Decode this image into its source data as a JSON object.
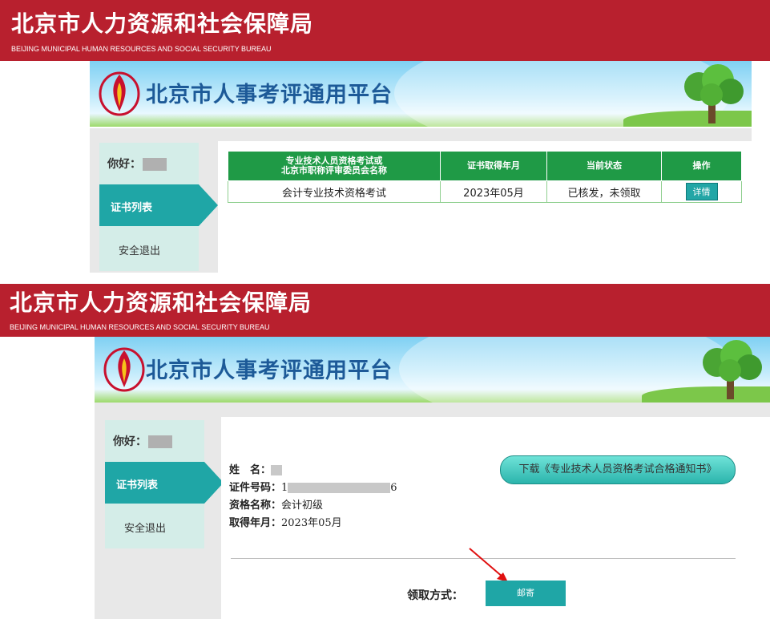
{
  "header": {
    "title_cn": "北京市人力资源和社会保障局",
    "title_en": "BEIJING MUNICIPAL HUMAN RESOURCES AND SOCIAL SECURITY BUREAU",
    "platform_title": "北京市人事考评通用平台"
  },
  "sidebar": {
    "greeting": "你好：",
    "items": [
      {
        "label": "证书列表"
      },
      {
        "label": "安全退出"
      }
    ]
  },
  "cert_table": {
    "headers": [
      "专业技术人员资格考试或\n北京市职称评审委员会名称",
      "证书取得年月",
      "当前状态",
      "操作"
    ],
    "rows": [
      {
        "name": "会计专业技术资格考试",
        "date": "2023年05月",
        "status": "已核发，未领取",
        "action": "详情"
      }
    ]
  },
  "detail": {
    "name_label": "姓　名：",
    "id_label": "证件号码：",
    "id_prefix": "1",
    "id_suffix": "6",
    "qual_label": "资格名称：",
    "qual_value": "会计初级",
    "date_label": "取得年月：",
    "date_value": "2023年05月",
    "download_label": "下载《专业技术人员资格考试合格通知书》",
    "pickup_label": "领取方式：",
    "pickup_value": "邮寄"
  },
  "colors": {
    "banner": "#b8202e",
    "accent_teal": "#1fa6a6",
    "table_header": "#1f9a46"
  }
}
